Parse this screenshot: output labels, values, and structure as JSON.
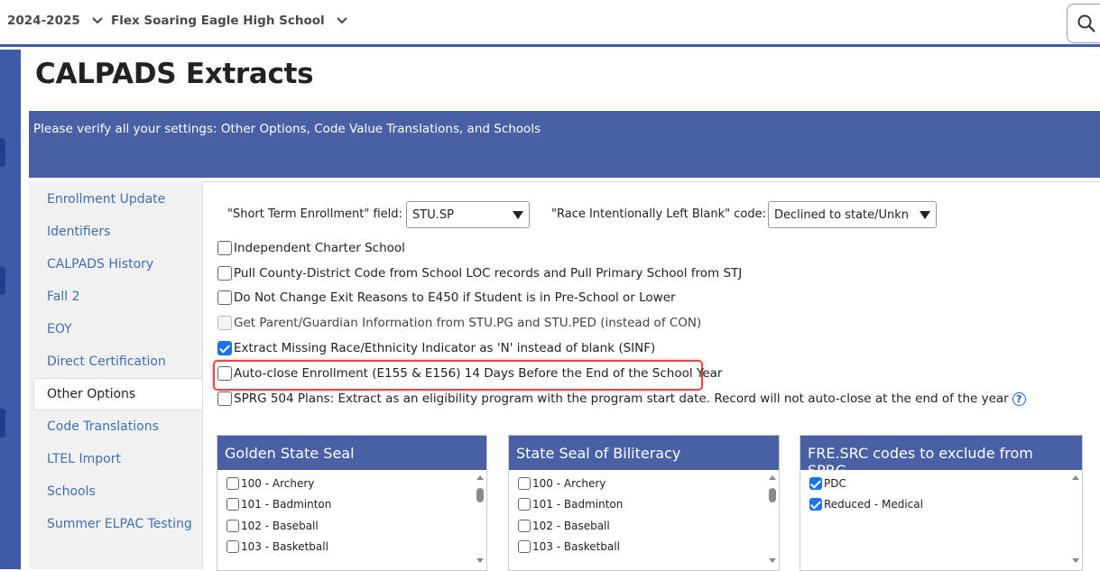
{
  "topbar": {
    "year": "2024-2025",
    "school": "Flex Soaring Eagle High School"
  },
  "page": {
    "title": "CALPADS Extracts",
    "banner": "Please verify all your settings: Other Options, Code Value Translations, and Schools"
  },
  "sidenav": {
    "items": [
      {
        "label": "Enrollment Update"
      },
      {
        "label": "Identifiers"
      },
      {
        "label": "CALPADS History"
      },
      {
        "label": "Fall 2"
      },
      {
        "label": "EOY"
      },
      {
        "label": "Direct Certification"
      },
      {
        "label": "Other Options"
      },
      {
        "label": "Code Translations"
      },
      {
        "label": "LTEL Import"
      },
      {
        "label": "Schools"
      },
      {
        "label": "Summer ELPAC Testing"
      }
    ],
    "active": "Other Options"
  },
  "fields": {
    "short_term_label": "\"Short Term Enrollment\" field:",
    "short_term_value": "STU.SP",
    "race_blank_label": "\"Race Intentionally Left Blank\" code:",
    "race_blank_value": "Declined to state/Unknown"
  },
  "options": [
    {
      "label": "Independent Charter School",
      "checked": false,
      "disabled": false
    },
    {
      "label": "Pull County-District Code from School LOC records and Pull Primary School from STJ",
      "checked": false,
      "disabled": false
    },
    {
      "label": "Do Not Change Exit Reasons to E450 if Student is in Pre-School or Lower",
      "checked": false,
      "disabled": false
    },
    {
      "label": "Get Parent/Guardian Information from STU.PG and STU.PED (instead of CON)",
      "checked": false,
      "disabled": true
    },
    {
      "label": "Extract Missing Race/Ethnicity Indicator as 'N' instead of blank (SINF)",
      "checked": true,
      "disabled": false
    },
    {
      "label": "Auto-close Enrollment (E155 & E156) 14 Days Before the End of the School Year",
      "checked": false,
      "disabled": false
    },
    {
      "label": "SPRG 504 Plans: Extract as an eligibility program with the program start date. Record will not auto-close at the end of the year",
      "checked": false,
      "disabled": false
    }
  ],
  "panels": [
    {
      "title": "Golden State Seal",
      "items": [
        {
          "label": "100 - Archery",
          "checked": false
        },
        {
          "label": "101 - Badminton",
          "checked": false
        },
        {
          "label": "102 - Baseball",
          "checked": false
        },
        {
          "label": "103 - Basketball",
          "checked": false
        }
      ]
    },
    {
      "title": "State Seal of Biliteracy",
      "items": [
        {
          "label": "100 - Archery",
          "checked": false
        },
        {
          "label": "101 - Badminton",
          "checked": false
        },
        {
          "label": "102 - Baseball",
          "checked": false
        },
        {
          "label": "103 - Basketball",
          "checked": false
        }
      ]
    },
    {
      "title": "FRE.SRC codes to exclude from SPRG",
      "items": [
        {
          "label": "PDC",
          "checked": true
        },
        {
          "label": "Reduced - Medical",
          "checked": true
        }
      ]
    }
  ],
  "colors": {
    "accent": "#4961a4",
    "link": "#3d6fb4",
    "highlight": "#e14b4b",
    "checkbox": "#1a73e8"
  }
}
